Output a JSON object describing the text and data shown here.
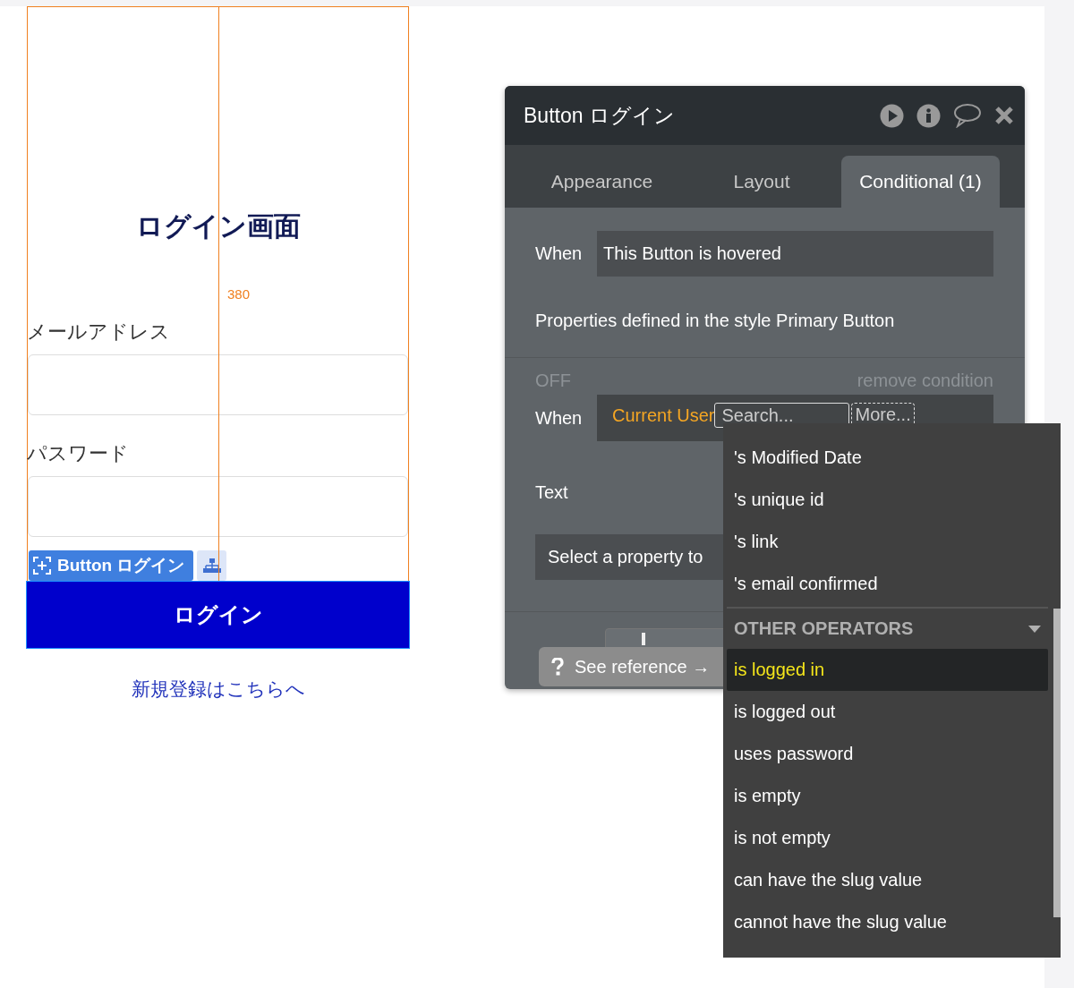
{
  "canvas": {
    "title": "ログイン画面",
    "width_label": "380",
    "email_label": "メールアドレス",
    "password_label": "パスワード",
    "element_tag": "Button ログイン",
    "login_button": "ログイン",
    "signup_link": "新規登録はこちらへ"
  },
  "panel": {
    "title": "Button ログイン",
    "tabs": [
      {
        "label": "Appearance",
        "selected": false
      },
      {
        "label": "Layout",
        "selected": false
      },
      {
        "label": "Conditional (1)",
        "selected": true
      }
    ],
    "condition_1": {
      "when": "When",
      "expression": "This Button is hovered",
      "note": "Properties defined in the style Primary Button"
    },
    "condition_2": {
      "status": "OFF",
      "remove": "remove condition",
      "when": "When",
      "source": "Current User",
      "search_placeholder": "Search...",
      "more": "More...",
      "text_label": "Text",
      "property_placeholder": "Select a property to"
    },
    "reference": "See reference →"
  },
  "dropdown": [
    {
      "kind": "item",
      "label": "'s Modified Date",
      "selected": false
    },
    {
      "kind": "item",
      "label": "'s unique id",
      "selected": false
    },
    {
      "kind": "item",
      "label": "'s link",
      "selected": false
    },
    {
      "kind": "item",
      "label": "'s email confirmed",
      "selected": false
    },
    {
      "kind": "header",
      "label": "OTHER OPERATORS"
    },
    {
      "kind": "item",
      "label": "is logged in",
      "selected": true
    },
    {
      "kind": "item",
      "label": "is logged out",
      "selected": false
    },
    {
      "kind": "item",
      "label": "uses password",
      "selected": false
    },
    {
      "kind": "item",
      "label": "is empty",
      "selected": false
    },
    {
      "kind": "item",
      "label": "is not empty",
      "selected": false
    },
    {
      "kind": "item",
      "label": "can have the slug value",
      "selected": false
    },
    {
      "kind": "item",
      "label": "cannot have the slug value",
      "selected": false
    }
  ]
}
